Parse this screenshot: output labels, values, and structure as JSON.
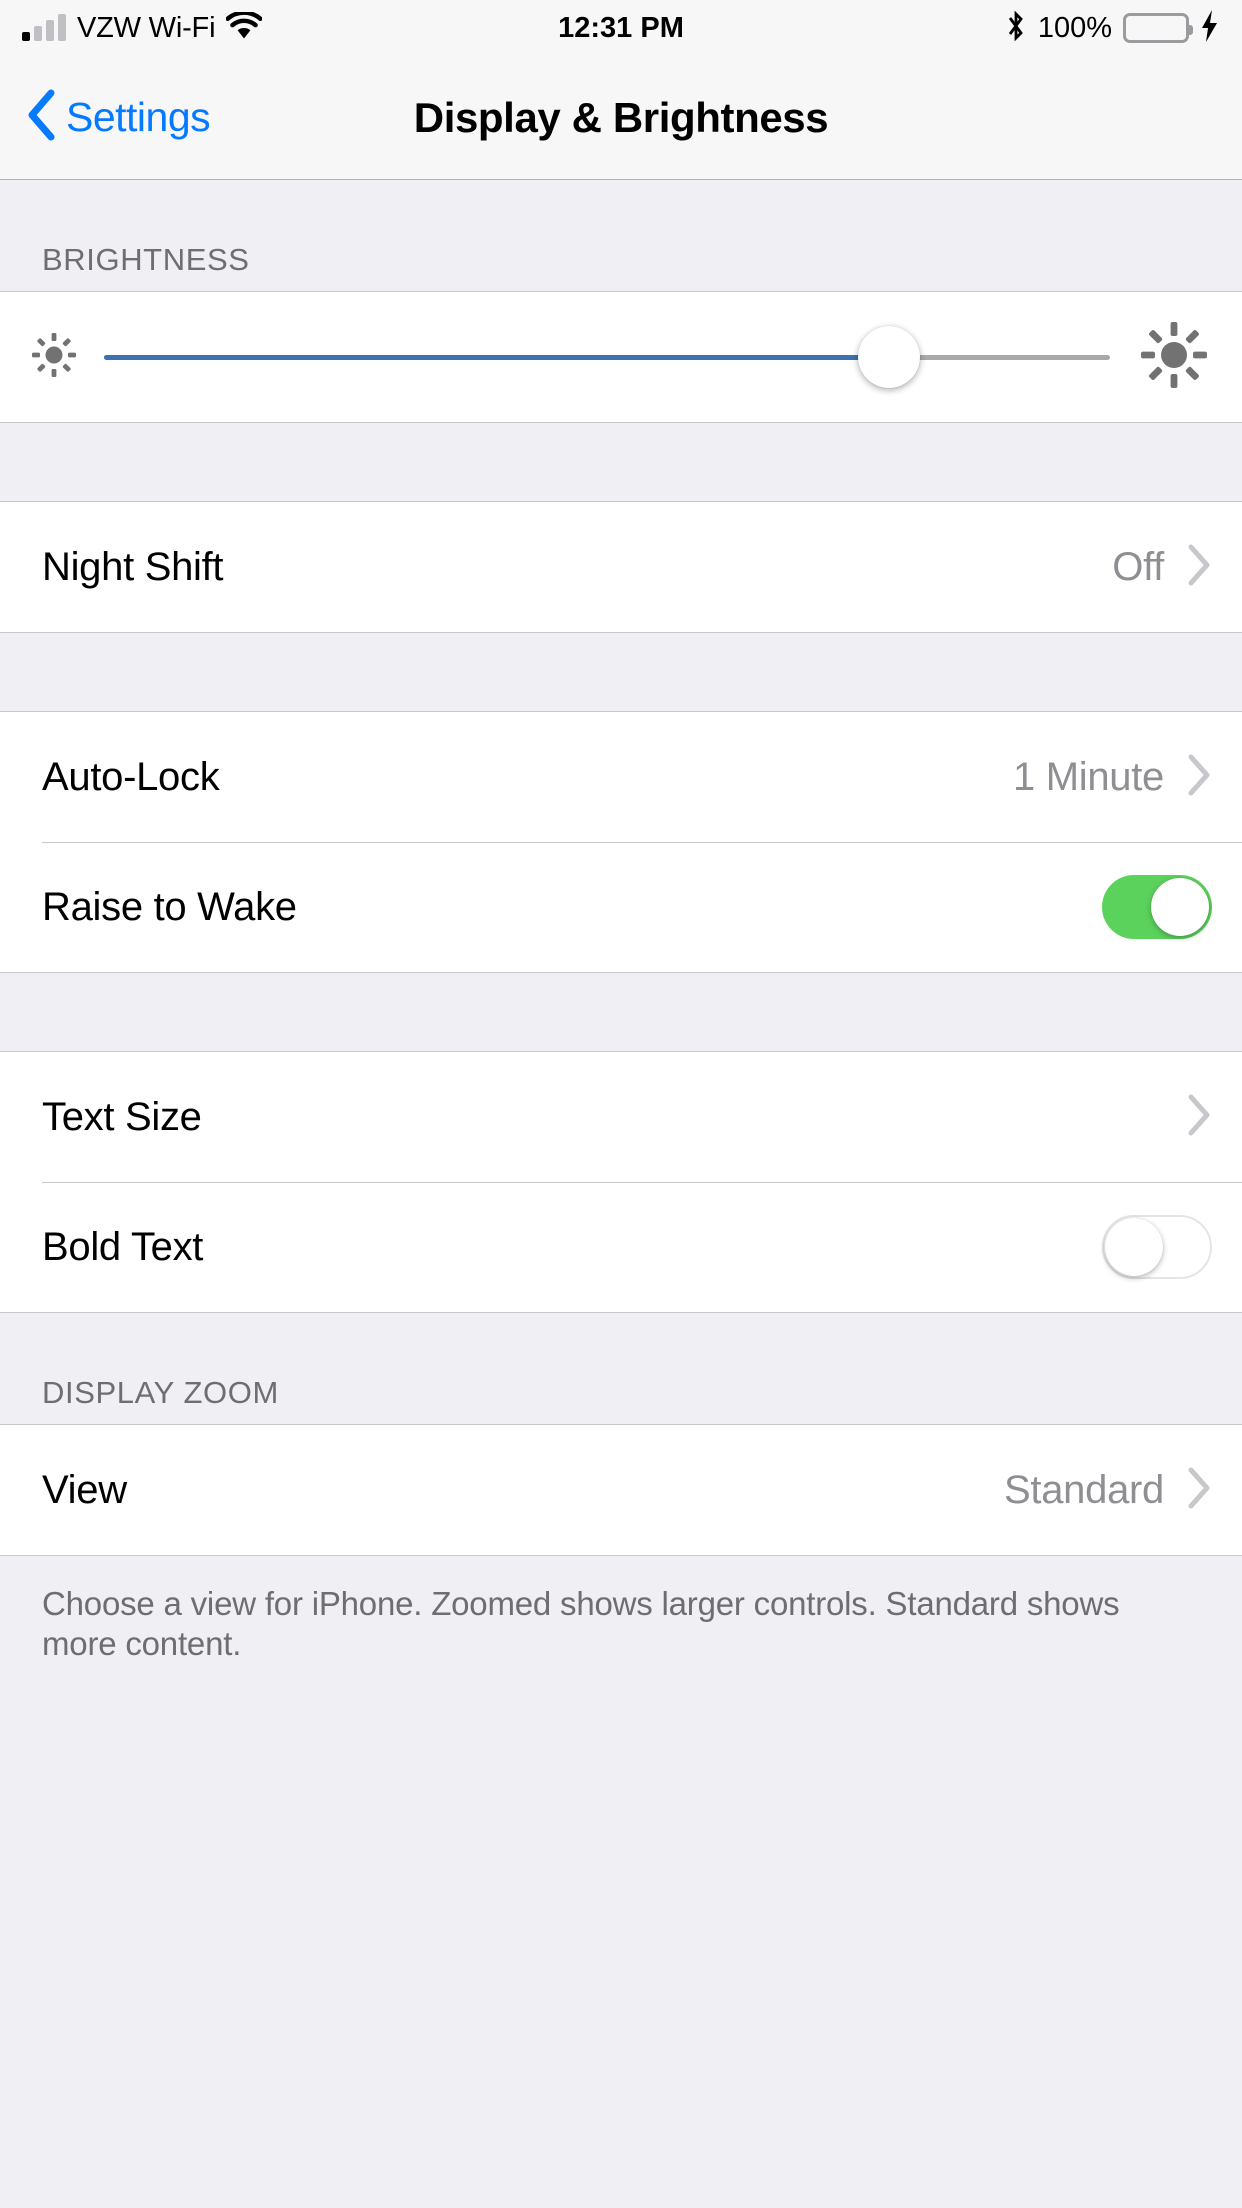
{
  "status_bar": {
    "carrier": "VZW Wi-Fi",
    "signal_icon": "signal-bars-icon",
    "wifi_icon": "wifi-icon",
    "time": "12:31 PM",
    "bluetooth_icon": "bluetooth-icon",
    "battery_percent": "100%",
    "battery_icon": "battery-icon",
    "charging_icon": "lightning-bolt-icon",
    "battery_level": 100,
    "battery_color": "#62D053"
  },
  "nav_bar": {
    "back_label": "Settings",
    "back_icon": "chevron-left-icon",
    "title": "Display & Brightness",
    "tint_color": "#067AFE"
  },
  "brightness": {
    "header": "BRIGHTNESS",
    "slider": {
      "value": 78,
      "min_icon": "sun-small-icon",
      "max_icon": "sun-large-icon",
      "fill_color": "#3C72B0",
      "track_color": "#A9A9A9"
    }
  },
  "night_shift_group": {
    "rows": [
      {
        "title": "Night Shift",
        "value": "Off",
        "accessory": "chevron-right-icon"
      }
    ]
  },
  "lock_group": {
    "rows": [
      {
        "title": "Auto-Lock",
        "value": "1 Minute",
        "accessory": "chevron-right-icon"
      },
      {
        "title": "Raise to Wake",
        "value": "",
        "accessory": "toggle-on"
      }
    ]
  },
  "text_group": {
    "rows": [
      {
        "title": "Text Size",
        "value": "",
        "accessory": "chevron-right-icon"
      },
      {
        "title": "Bold Text",
        "value": "",
        "accessory": "toggle-off"
      }
    ]
  },
  "display_zoom": {
    "header": "DISPLAY ZOOM",
    "rows": [
      {
        "title": "View",
        "value": "Standard",
        "accessory": "chevron-right-icon"
      }
    ],
    "footer": "Choose a view for iPhone. Zoomed shows larger controls. Standard shows more content."
  },
  "colors": {
    "group_bg": "#EFEFF4",
    "cell_bg": "#FFFFFF",
    "separator": "#C8C7CC",
    "secondary_text": "#8E8E93",
    "switch_on": "#5BD25B"
  }
}
